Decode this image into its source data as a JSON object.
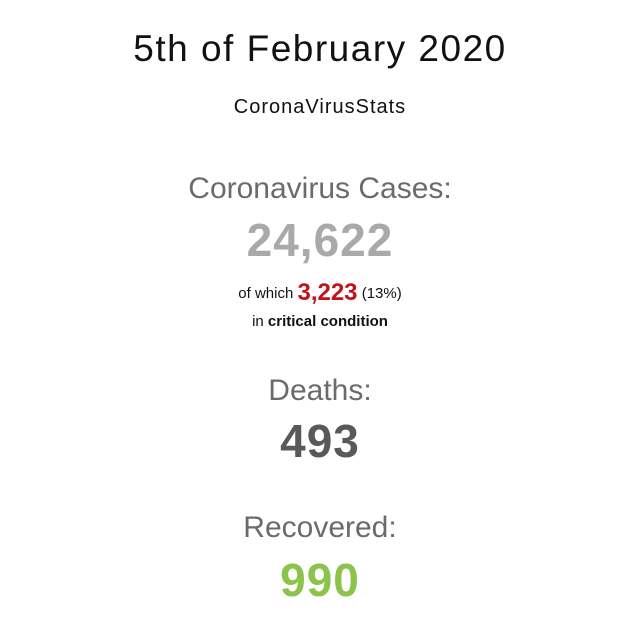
{
  "header": {
    "date": "5th of February 2020",
    "brand": "CoronaVirusStats"
  },
  "cases": {
    "label": "Coronavirus Cases:",
    "value": "24,622",
    "critical_prefix": "of which",
    "critical_value": "3,223",
    "critical_percent": "(13%)",
    "critical_in": "in",
    "critical_condition": "critical condition"
  },
  "deaths": {
    "label": "Deaths:",
    "value": "493"
  },
  "recovered": {
    "label": "Recovered:",
    "value": "990"
  },
  "colors": {
    "cases_number": "#a9a9a9",
    "critical_value": "#c0141a",
    "deaths_number": "#595959",
    "recovered_number": "#8cc34b",
    "label": "#6b6b6b"
  }
}
